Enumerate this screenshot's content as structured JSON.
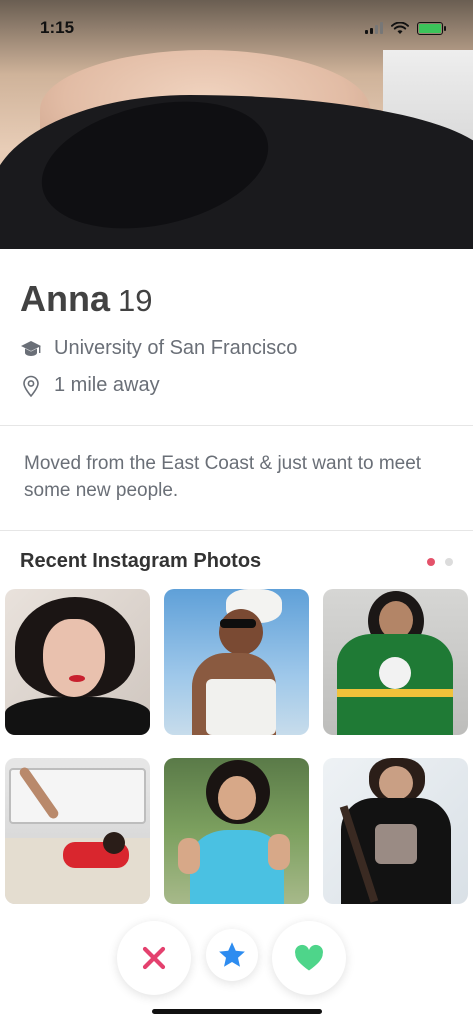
{
  "status_bar": {
    "time": "1:15",
    "battery_color": "#3cc45a"
  },
  "profile": {
    "name": "Anna",
    "age": "19",
    "school": "University of San Francisco",
    "distance": "1 mile away",
    "bio": "Moved from the East Coast & just want to meet some new people."
  },
  "instagram": {
    "title": "Recent Instagram Photos",
    "page_dots": [
      {
        "active": true,
        "color": "#e4526a"
      },
      {
        "active": false,
        "color": "#dcdcdc"
      }
    ],
    "photos": [
      {
        "icon": "portrait-photo"
      },
      {
        "icon": "towel-sunglasses-photo"
      },
      {
        "icon": "green-jersey-photo"
      },
      {
        "icon": "couch-pose-photo"
      },
      {
        "icon": "peace-sign-photo"
      },
      {
        "icon": "band-tee-photo"
      }
    ]
  },
  "actions": {
    "nope_icon": "close-icon",
    "nope_color": "#e4416e",
    "super_like_icon": "star-icon",
    "super_like_color": "#2d8cf0",
    "like_icon": "heart-icon",
    "like_color": "#4ed58a"
  }
}
